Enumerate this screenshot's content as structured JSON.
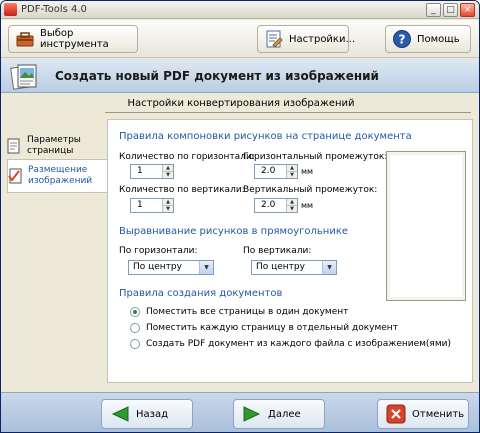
{
  "window": {
    "title": "PDF-Tools 4.0",
    "minimize": "_",
    "maximize": "□",
    "close": "×"
  },
  "toolbar": {
    "select_tool_label": "Выбор инструмента",
    "settings_label": "Настройки...",
    "help_label": "Помощь"
  },
  "header": {
    "title": "Создать новый PDF документ из изображений"
  },
  "section_caption": "Настройки конвертирования изображений",
  "nav": {
    "items": [
      {
        "label_line1": "Параметры",
        "label_line2": "страницы"
      },
      {
        "label_line1": "Размещение",
        "label_line2": "изображений"
      }
    ]
  },
  "layout_group": {
    "title": "Правила компоновки рисунков на странице документа",
    "h_count_label": "Количество по горизонтали:",
    "h_count_value": "1",
    "h_gap_label": "Горизонтальный промежуток:",
    "h_gap_value": "2.0",
    "h_gap_unit": "мм",
    "v_count_label": "Количество по вертикали:",
    "v_count_value": "1",
    "v_gap_label": "Вертикальный промежуток:",
    "v_gap_value": "2.0",
    "v_gap_unit": "мм"
  },
  "align_group": {
    "title": "Выравнивание рисунков в прямоугольнике",
    "h_label": "По горизонтали:",
    "h_value": "По центру",
    "v_label": "По вертикали:",
    "v_value": "По центру"
  },
  "doc_group": {
    "title": "Правила создания документов",
    "options": [
      {
        "label": "Поместить все страницы в один документ",
        "checked": true
      },
      {
        "label": "Поместить каждую страницу в отдельный документ",
        "checked": false
      },
      {
        "label": "Создать PDF документ из каждого файла с изображением(ями)",
        "checked": false
      }
    ]
  },
  "footer": {
    "back_label": "Назад",
    "next_label": "Далее",
    "cancel_label": "Отменить"
  },
  "colors": {
    "accent_blue": "#2359a6",
    "nav_green": "#2d9a2d",
    "cancel_red": "#d6452b"
  }
}
